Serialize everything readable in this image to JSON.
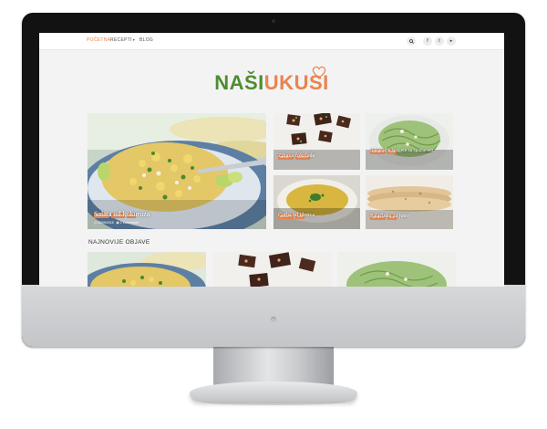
{
  "nav": {
    "items": [
      "POČETNA",
      "RECEPTI",
      "BLOG"
    ],
    "search_icon": "search-icon",
    "social_icons": [
      "facebook-icon",
      "twitter-icon",
      "youtube-icon"
    ]
  },
  "logo": {
    "part1": "NAŠI",
    "part2": "UKUSI"
  },
  "featured": {
    "main": {
      "tags": [
        "RECEPTI",
        "SALATE",
        "SVE"
      ],
      "title": "Salata od kukuruza",
      "date": "02/09/2018",
      "comments": "2 Komentara"
    },
    "cards": [
      {
        "tags": [
          "RECEPTI",
          "SLATKO"
        ],
        "title": "Zdrava čokolada"
      },
      {
        "tags": [
          "RECEPTI",
          "SVE"
        ],
        "title": "Integralne špagete sa spanaćem"
      },
      {
        "tags": [
          "RECEPTI",
          "SVE"
        ],
        "title": "Čorba od tikvica"
      },
      {
        "tags": [
          "RECEPTI",
          "SVE"
        ],
        "title": "Palačinke za jutro"
      }
    ]
  },
  "latest": {
    "title": "NAJNOVIJE OBJAVE"
  },
  "colors": {
    "accent": "#e8844f",
    "brand_green": "#4f8d2f"
  }
}
